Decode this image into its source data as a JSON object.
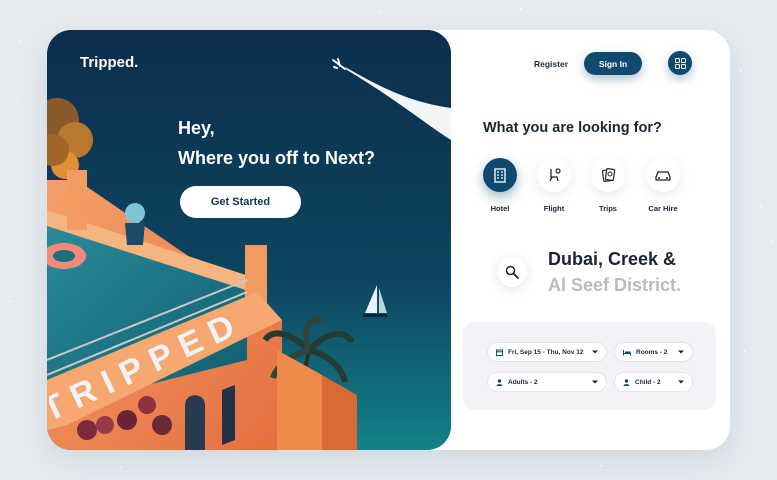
{
  "hero": {
    "brand": "Tripped.",
    "greeting_line1": "Hey,",
    "greeting_line2": "Where you off to Next?",
    "cta_label": "Get Started",
    "sign_text": "TRIPPED"
  },
  "nav": {
    "register_label": "Register",
    "signin_label": "Sign In",
    "menu_icon": "grid-icon"
  },
  "search": {
    "heading": "What you are looking for?",
    "categories": [
      {
        "label": "Hotel",
        "icon": "hotel-icon",
        "active": true
      },
      {
        "label": "Flight",
        "icon": "seat-icon",
        "active": false
      },
      {
        "label": "Trips",
        "icon": "passport-icon",
        "active": false
      },
      {
        "label": "Car Hire",
        "icon": "car-icon",
        "active": false
      }
    ],
    "location_line1": "Dubai, Creek &",
    "location_line2": "Al Seef District."
  },
  "filters": {
    "dates": "Fri, Sep 15 - Thu, Nov 12",
    "rooms": "Rooms - 2",
    "adults": "Adults - 2",
    "child": "Child - 2"
  },
  "colors": {
    "primary": "#104a6e",
    "hero_bg": "#0c2d4c",
    "page_bg": "#e6ebef"
  }
}
